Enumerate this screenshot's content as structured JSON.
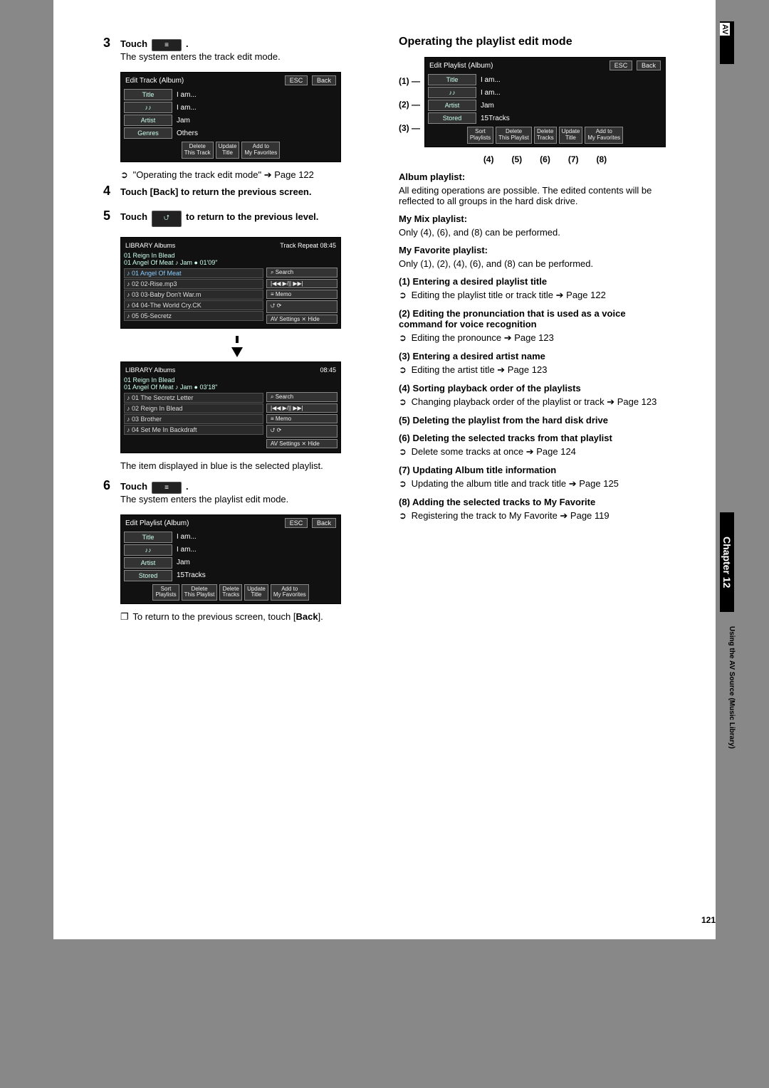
{
  "left": {
    "step3": {
      "num": "3",
      "prefix": "Touch",
      "icon": "≡",
      "suffix": ".",
      "desc": "The system enters the track edit mode."
    },
    "shot1": {
      "title": "Edit Track (Album)",
      "esc": "ESC",
      "back": "Back",
      "rows": [
        {
          "label": "Title",
          "value": "I am..."
        },
        {
          "label": "♪♪",
          "value": "I am..."
        },
        {
          "label": "Artist",
          "value": "Jam"
        },
        {
          "label": "Genres",
          "value": "Others"
        }
      ],
      "toolbar": [
        "Delete\nThis Track",
        "Update\nTitle",
        "Add to\nMy Favorites"
      ]
    },
    "ref1": {
      "icon": "➲",
      "text": "\"Operating the track edit mode\" ➔ Page 122"
    },
    "step4": {
      "num": "4",
      "text": "Touch [Back] to return the previous screen."
    },
    "step5": {
      "num": "5",
      "prefix": "Touch",
      "icon": "⮍",
      "suffix": "to return to the previous level."
    },
    "shot2": {
      "header_left": "LIBRARY  Albums",
      "header_right": "Track   Repeat        08:45",
      "top_lines": [
        "01  Reign In Blead",
        "01  Angel Of Meat    ♪  Jam       ●  01'09\""
      ],
      "rows": [
        "01 Angel Of Meat",
        "02 02-Rise.mp3",
        "03 03-Baby Don't War.m",
        "04 04-The World Cry.CK",
        "05 05-Secretz"
      ],
      "side_buttons": [
        "⌕ Search",
        "|◀◀      ▶/||      ▶▶|",
        "≡            Memo",
        "⮍            ⟳",
        "AV Settings    ⨯ Hide"
      ]
    },
    "shot3": {
      "header_left": "LIBRARY  Albums",
      "header_right": "08:45",
      "top_lines": [
        "01  Reign In Blead",
        "01  Angel Of Meat    ♪  Jam       ●  03'18\""
      ],
      "rows": [
        "01 The Secretz Letter",
        "02 Reign In Blead",
        "03 Brother",
        "04 Set Me In Backdraft"
      ],
      "side_buttons": [
        "⌕ Search",
        "|◀◀      ▶/||      ▶▶|",
        "≡            Memo",
        "⮍            ⟳",
        "AV Settings    ⨯ Hide"
      ]
    },
    "blue_note": "The item displayed in blue is the selected playlist.",
    "step6": {
      "num": "6",
      "prefix": "Touch",
      "icon": "≡",
      "suffix": ".",
      "desc": "The system enters the playlist edit mode."
    },
    "shot4": {
      "title": "Edit Playlist (Album)",
      "esc": "ESC",
      "back": "Back",
      "rows": [
        {
          "label": "Title",
          "value": "I am..."
        },
        {
          "label": "♪♪",
          "value": "I am..."
        },
        {
          "label": "Artist",
          "value": "Jam"
        },
        {
          "label": "Stored",
          "value": "15Tracks"
        }
      ],
      "toolbar": [
        "Sort\nPlaylists",
        "Delete\nThis Playlist",
        "Delete\nTracks",
        "Update\nTitle",
        "Add to\nMy Favorites"
      ]
    },
    "return_note": {
      "icon": "❐",
      "text": "To return to the previous screen, touch [",
      "bold": "Back",
      "tail": "]."
    }
  },
  "right": {
    "heading": "Operating the playlist edit mode",
    "callouts_left": [
      "(1)",
      "(2)",
      "(3)"
    ],
    "callouts_bottom": [
      "(4)",
      "(5)",
      "(6)",
      "(7)",
      "(8)"
    ],
    "shot": {
      "title": "Edit Playlist (Album)",
      "esc": "ESC",
      "back": "Back",
      "rows": [
        {
          "label": "Title",
          "value": "I am..."
        },
        {
          "label": "♪♪",
          "value": "I am..."
        },
        {
          "label": "Artist",
          "value": "Jam"
        },
        {
          "label": "Stored",
          "value": "15Tracks"
        }
      ],
      "toolbar": [
        "Sort\nPlaylists",
        "Delete\nThis Playlist",
        "Delete\nTracks",
        "Update\nTitle",
        "Add to\nMy Favorites"
      ]
    },
    "album_head": "Album playlist:",
    "album_text": "All editing operations are possible. The edited contents will be reflected to all groups in the hard disk drive.",
    "mymix_head": "My Mix playlist:",
    "mymix_text": "Only (4), (6), and (8) can be performed.",
    "myfav_head": "My Favorite playlist:",
    "myfav_text": "Only (1), (2), (4), (6), and (8) can be performed.",
    "items": [
      {
        "h": "(1) Entering a desired playlist title",
        "icon": "➲",
        "t": "Editing the playlist title or track title ➔ Page 122"
      },
      {
        "h": "(2) Editing the pronunciation that is used as a voice command for voice recognition",
        "icon": "➲",
        "t": "Editing the pronounce ➔ Page 123"
      },
      {
        "h": "(3) Entering a desired artist name",
        "icon": "➲",
        "t": "Editing the artist title ➔ Page 123"
      },
      {
        "h": "(4) Sorting playback order of the playlists",
        "icon": "➲",
        "t": "Changing playback order of the playlist or track ➔ Page 123"
      },
      {
        "h": "(5) Deleting the playlist from the hard disk drive",
        "icon": "",
        "t": ""
      },
      {
        "h": "(6) Deleting the selected tracks from that playlist",
        "icon": "➲",
        "t": "Delete some tracks at once ➔ Page 124"
      },
      {
        "h": "(7) Updating Album title information",
        "icon": "➲",
        "t": "Updating the album title and track title ➔ Page 125"
      },
      {
        "h": "(8) Adding the selected tracks to My Favorite",
        "icon": "➲",
        "t": "Registering the track to My Favorite ➔ Page 119"
      }
    ]
  },
  "side": {
    "av": "AV",
    "chapter": "Chapter 12",
    "sub": "Using the AV Source (Music Library)"
  },
  "page_number": "121"
}
